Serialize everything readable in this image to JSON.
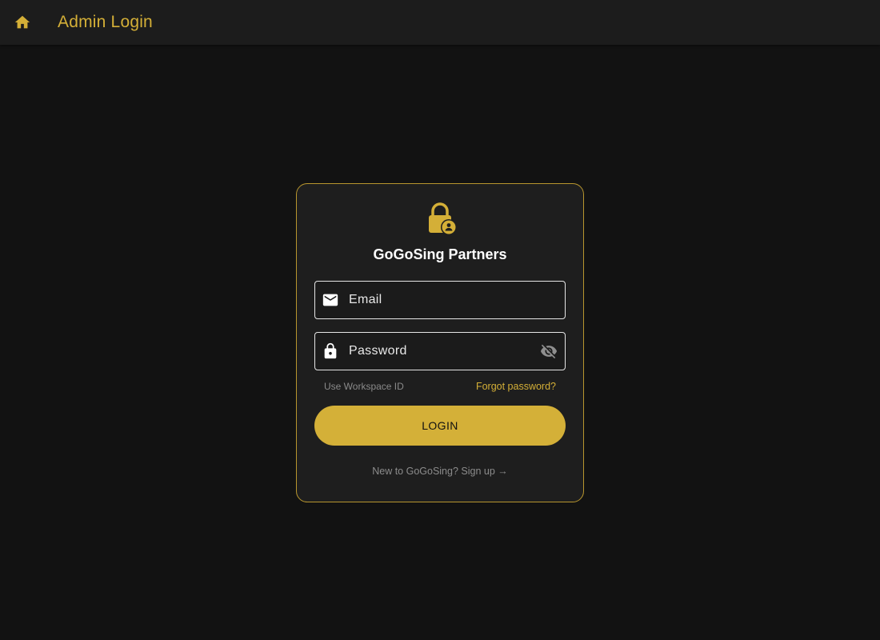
{
  "appbar": {
    "title": "Admin Login",
    "home_icon": "home-icon"
  },
  "card": {
    "logo_icon": "lock-person-icon",
    "heading": "GoGoSing Partners"
  },
  "email": {
    "placeholder": "Email",
    "value": "",
    "icon": "mail-icon"
  },
  "password": {
    "placeholder": "Password",
    "value": "",
    "icon": "lock-icon",
    "toggle_icon": "visibility-off-icon"
  },
  "links": {
    "workspace": "Use Workspace ID",
    "forgot": "Forgot password?"
  },
  "login_button": "LOGIN",
  "signup": "New to GoGoSing? Sign up →",
  "colors": {
    "accent": "#d4af37",
    "background": "#121212",
    "appbar": "#1c1c1c",
    "card": "#1e1e1e"
  }
}
